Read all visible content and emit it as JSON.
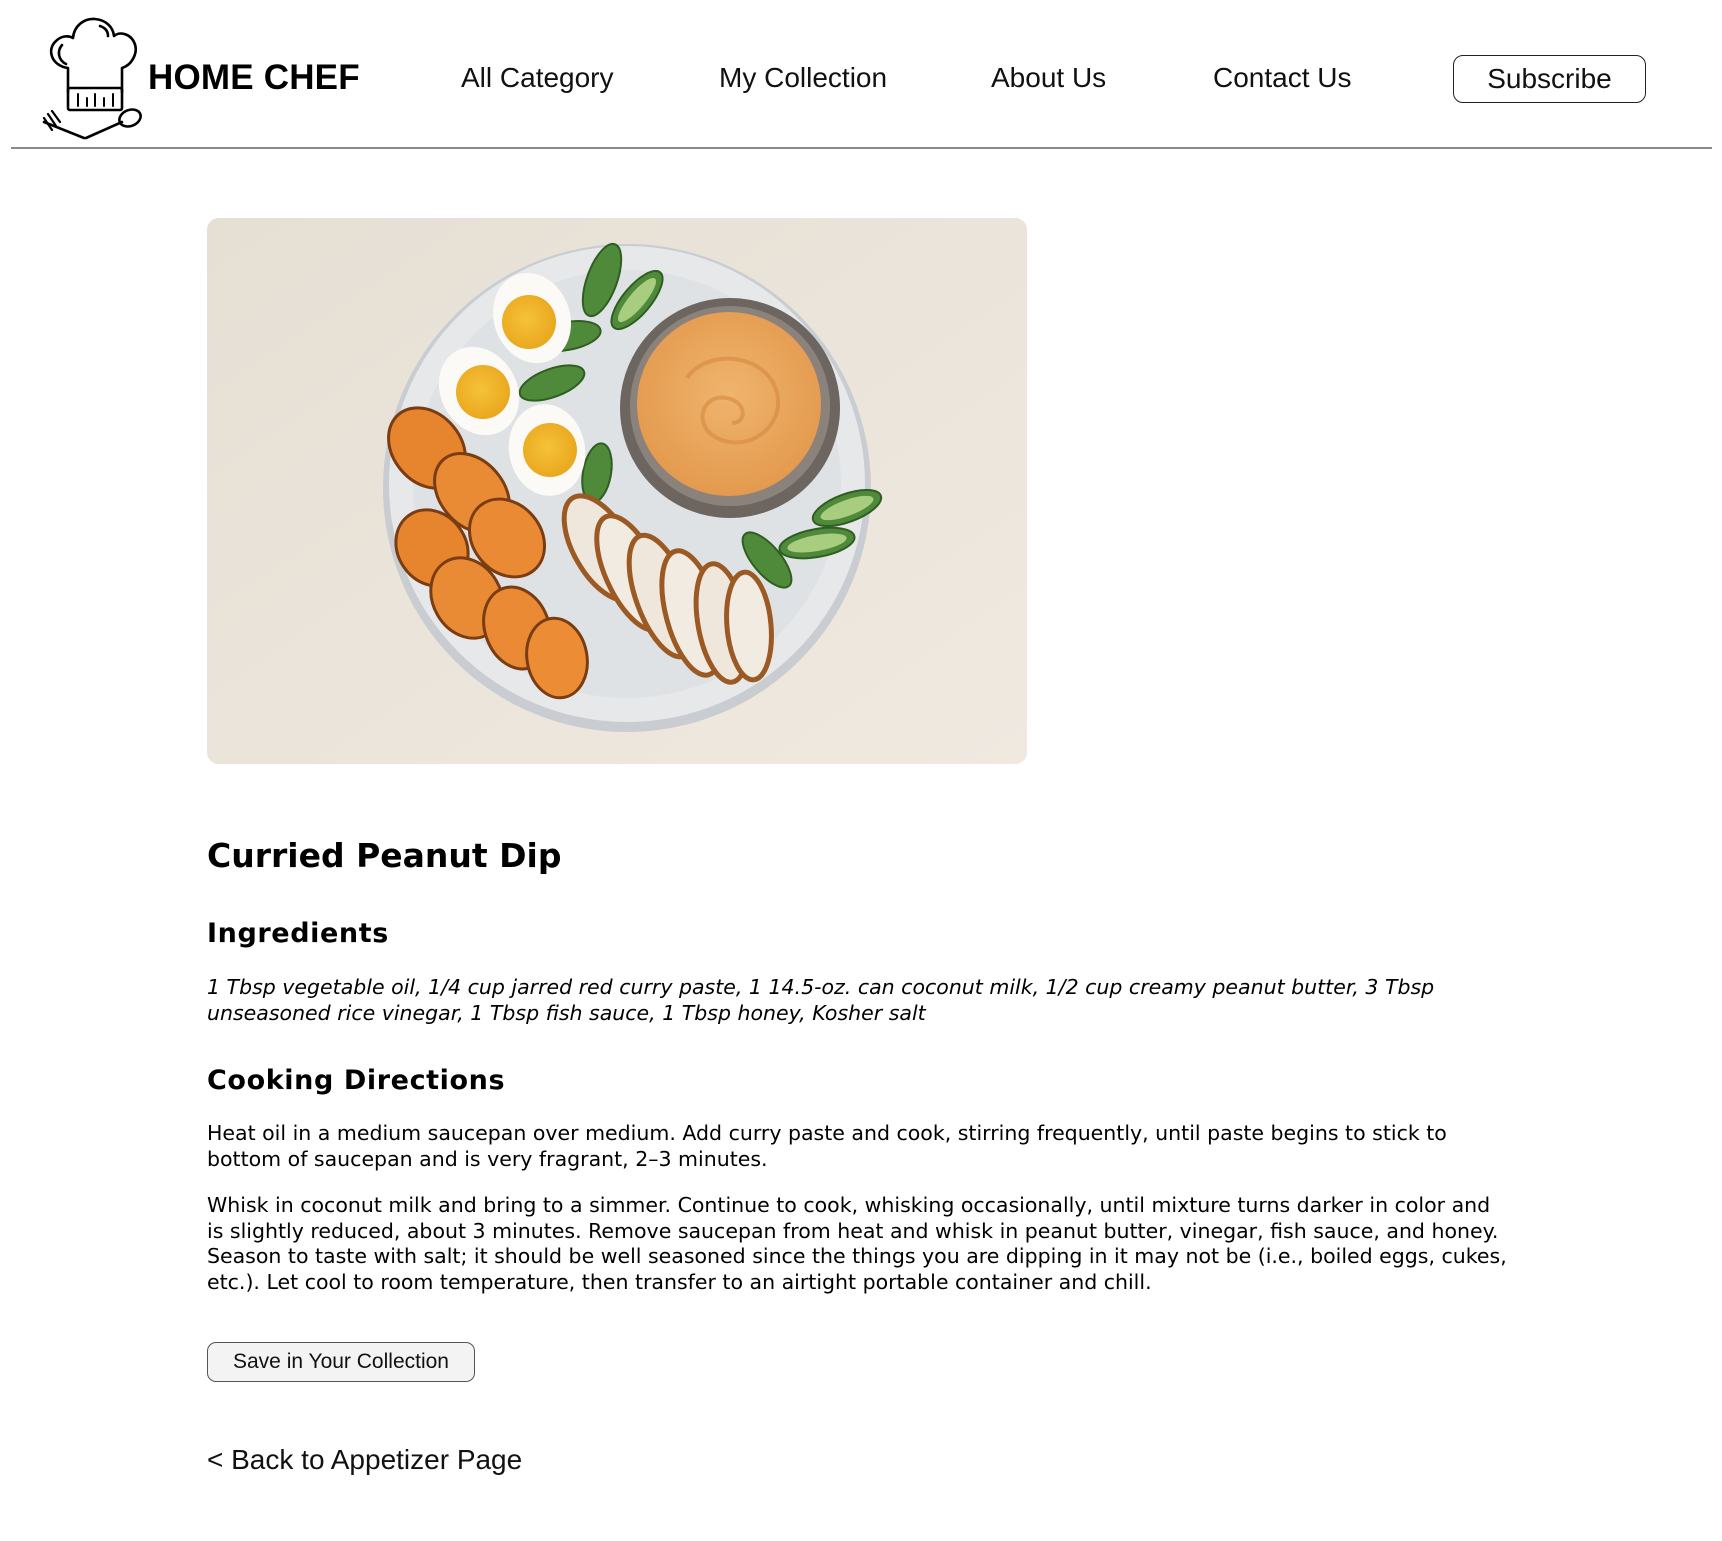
{
  "header": {
    "brand": "HOME CHEF",
    "nav": [
      "All Category",
      "My Collection",
      "About Us",
      "Contact Us"
    ],
    "subscribe_label": "Subscribe",
    "logo_icon": "chef-hat-icon"
  },
  "recipe": {
    "image_alt": "Plate with curried peanut dip, boiled eggs, cucumbers, roasted sweet potatoes and sliced chicken",
    "title": "Curried Peanut Dip",
    "ingredients_heading": "Ingredients",
    "ingredients": "1 Tbsp vegetable oil, 1/4 cup jarred red curry paste, 1 14.5-oz. can coconut milk, 1/2 cup creamy peanut butter, 3 Tbsp unseasoned rice vinegar, 1 Tbsp fish sauce, 1 Tbsp honey, Kosher salt",
    "directions_heading": "Cooking Directions",
    "directions": [
      "Heat oil in a medium saucepan over medium. Add curry paste and cook, stirring frequently, until paste begins to stick to bottom of saucepan and is very fragrant, 2–3 minutes.",
      "Whisk in coconut milk and bring to a simmer. Continue to cook, whisking occasionally, until mixture turns darker in color and is slightly reduced, about 3 minutes. Remove saucepan from heat and whisk in peanut butter, vinegar, fish sauce, and honey. Season to taste with salt; it should be well seasoned since the things you are dipping in it may not be (i.e., boiled eggs, cukes, etc.). Let cool to room temperature, then transfer to an airtight portable container and chill."
    ],
    "save_label": "Save in Your Collection",
    "back_label": "< Back to Appetizer Page"
  }
}
